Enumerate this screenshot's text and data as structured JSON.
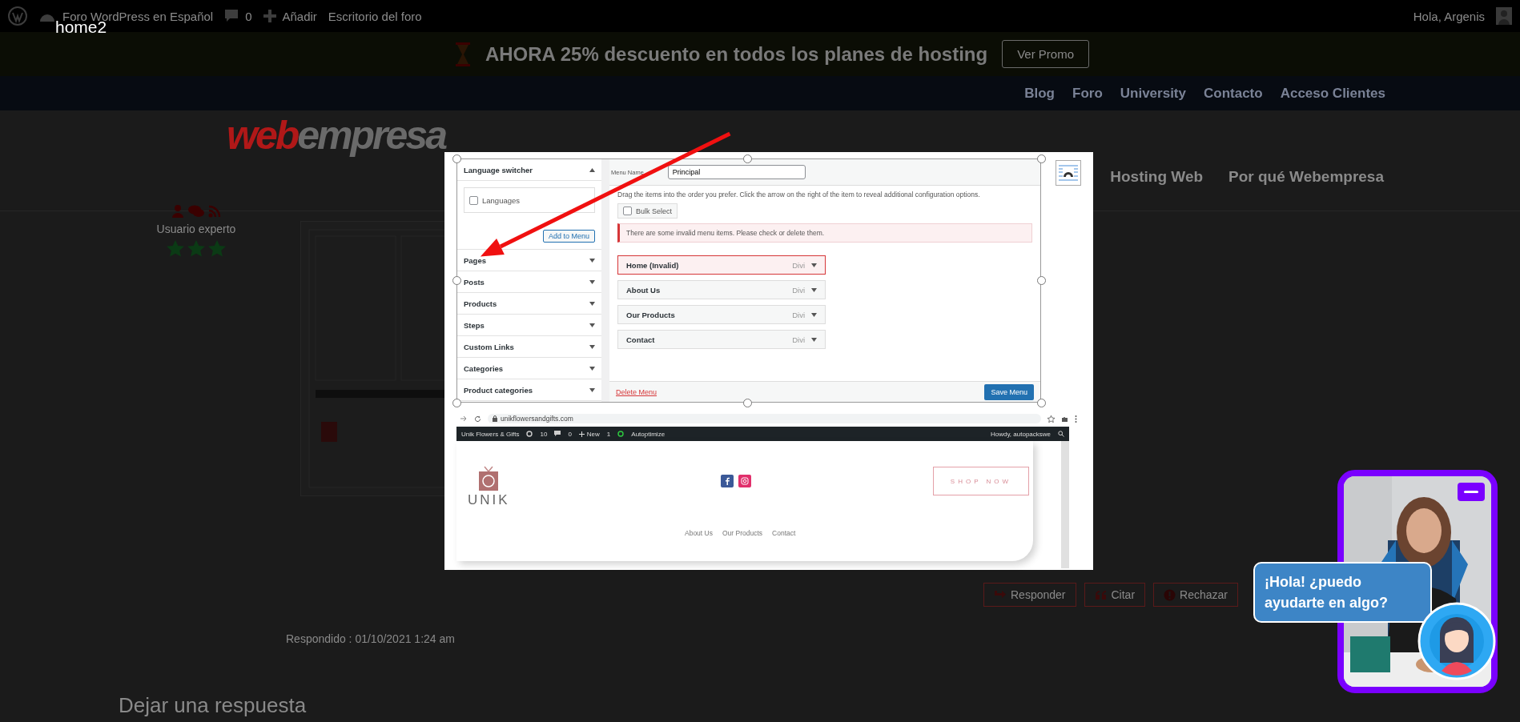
{
  "lightbox_title": "home2",
  "admin_bar": {
    "site": "Foro WordPress en Español",
    "comments": "0",
    "add": "Añadir",
    "dashboard": "Escritorio del foro",
    "greeting": "Hola, Argenis"
  },
  "promo": {
    "text": "AHORA 25% descuento en todos los planes de hosting",
    "button": "Ver Promo"
  },
  "top_nav": [
    "Blog",
    "Foro",
    "University",
    "Contacto",
    "Acceso Clientes"
  ],
  "header": {
    "logo_accent": "web",
    "logo_rest": "empresa",
    "menu": [
      "Hosting Web",
      "Por qué Webempresa"
    ]
  },
  "author": {
    "rank": "Usuario experto",
    "stars": 3
  },
  "post_actions": [
    {
      "label": "Responder",
      "kind": "reply"
    },
    {
      "label": "Citar",
      "kind": "quote"
    },
    {
      "label": "Rechazar",
      "kind": "report"
    }
  ],
  "reply_date": "Respondido : 01/10/2021 1:24 am",
  "reply_heading": "Dejar una respuesta",
  "lightbox": {
    "menu_editor": {
      "sections": [
        {
          "title": "Language switcher",
          "expanded": true,
          "options": [
            {
              "label": "Languages",
              "checked": false
            }
          ],
          "button": "Add to Menu"
        },
        {
          "title": "Pages",
          "expanded": false
        },
        {
          "title": "Posts",
          "expanded": false
        },
        {
          "title": "Products",
          "expanded": false
        },
        {
          "title": "Steps",
          "expanded": false
        },
        {
          "title": "Custom Links",
          "expanded": false
        },
        {
          "title": "Categories",
          "expanded": false
        },
        {
          "title": "Product categories",
          "expanded": false
        }
      ],
      "menu_name_label": "Menu Name",
      "menu_name": "Principal",
      "instructions": "Drag the items into the order you prefer. Click the arrow on the right of the item to reveal additional configuration options.",
      "bulk_select": {
        "label": "Bulk Select",
        "checked": false
      },
      "notice": "There are some invalid menu items. Please check or delete them.",
      "items": [
        {
          "title": "Home (Invalid)",
          "type": "Divi",
          "invalid": true
        },
        {
          "title": "About Us",
          "type": "Divi",
          "invalid": false
        },
        {
          "title": "Our Products",
          "type": "Divi",
          "invalid": false
        },
        {
          "title": "Contact",
          "type": "Divi",
          "invalid": false
        }
      ],
      "delete_link": "Delete Menu",
      "save_button": "Save Menu"
    },
    "browser": {
      "url": "unikflowersandgifts.com",
      "admin_bar": {
        "site": "Unik Flowers & Gifts",
        "updates": "10",
        "comments": "0",
        "new": "New",
        "count": "1",
        "plugin": "Autoptimize",
        "greeting": "Howdy, autopackswe"
      },
      "site": {
        "logo": "UNIK",
        "button": "SHOP NOW",
        "menu": [
          "About Us",
          "Our Products",
          "Contact"
        ]
      }
    }
  },
  "chat": {
    "message": "¡Hola! ¿puedo ayudarte en algo?"
  }
}
